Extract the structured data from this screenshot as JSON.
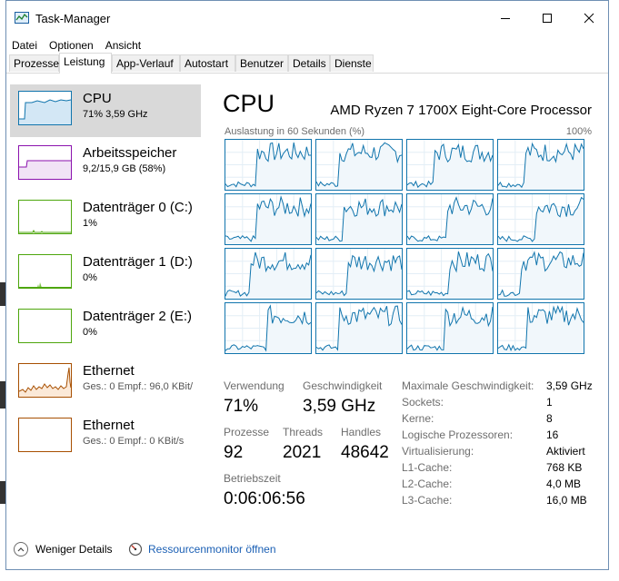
{
  "window": {
    "title": "Task-Manager"
  },
  "menu": [
    "Datei",
    "Optionen",
    "Ansicht"
  ],
  "tabs": [
    "Prozesse",
    "Leistung",
    "App-Verlauf",
    "Autostart",
    "Benutzer",
    "Details",
    "Dienste"
  ],
  "active_tab": "Leistung",
  "sidebar": [
    {
      "name": "CPU",
      "sub": "71% 3,59 GHz",
      "color": "#1175ad"
    },
    {
      "name": "Arbeitsspeicher",
      "sub": "9,2/15,9 GB (58%)",
      "color": "#8b12ae"
    },
    {
      "name": "Datenträger 0 (C:)",
      "sub": "1%",
      "color": "#4da60c"
    },
    {
      "name": "Datenträger 1 (D:)",
      "sub": "0%",
      "color": "#4da60c"
    },
    {
      "name": "Datenträger 2 (E:)",
      "sub": "0%",
      "color": "#4da60c"
    },
    {
      "name": "Ethernet",
      "sub": "Ges.: 0 Empf.: 96,0 KBit/",
      "color": "#a74f01"
    },
    {
      "name": "Ethernet",
      "sub": "Ges.: 0 Empf.: 0 KBit/s",
      "color": "#a74f01"
    }
  ],
  "main": {
    "title": "CPU",
    "model": "AMD Ryzen 7 1700X Eight-Core Processor",
    "graph_label": "Auslastung in 60 Sekunden (%)",
    "graph_max": "100%",
    "stats": {
      "usage_label": "Verwendung",
      "usage": "71%",
      "speed_label": "Geschwindigkeit",
      "speed": "3,59 GHz",
      "processes_label": "Prozesse",
      "processes": "92",
      "threads_label": "Threads",
      "threads": "2021",
      "handles_label": "Handles",
      "handles": "48642",
      "uptime_label": "Betriebszeit",
      "uptime": "0:06:06:56"
    },
    "right": [
      {
        "label": "Maximale Geschwindigkeit:",
        "value": "3,59 GHz"
      },
      {
        "label": "Sockets:",
        "value": "1"
      },
      {
        "label": "Kerne:",
        "value": "8"
      },
      {
        "label": "Logische Prozessoren:",
        "value": "16"
      },
      {
        "label": "Virtualisierung:",
        "value": "Aktiviert"
      },
      {
        "label": "L1-Cache:",
        "value": "768 KB"
      },
      {
        "label": "L2-Cache:",
        "value": "4,0 MB"
      },
      {
        "label": "L3-Cache:",
        "value": "16,0 MB"
      }
    ]
  },
  "footer": {
    "fewer": "Weniger Details",
    "resmon": "Ressourcenmonitor öffnen"
  }
}
